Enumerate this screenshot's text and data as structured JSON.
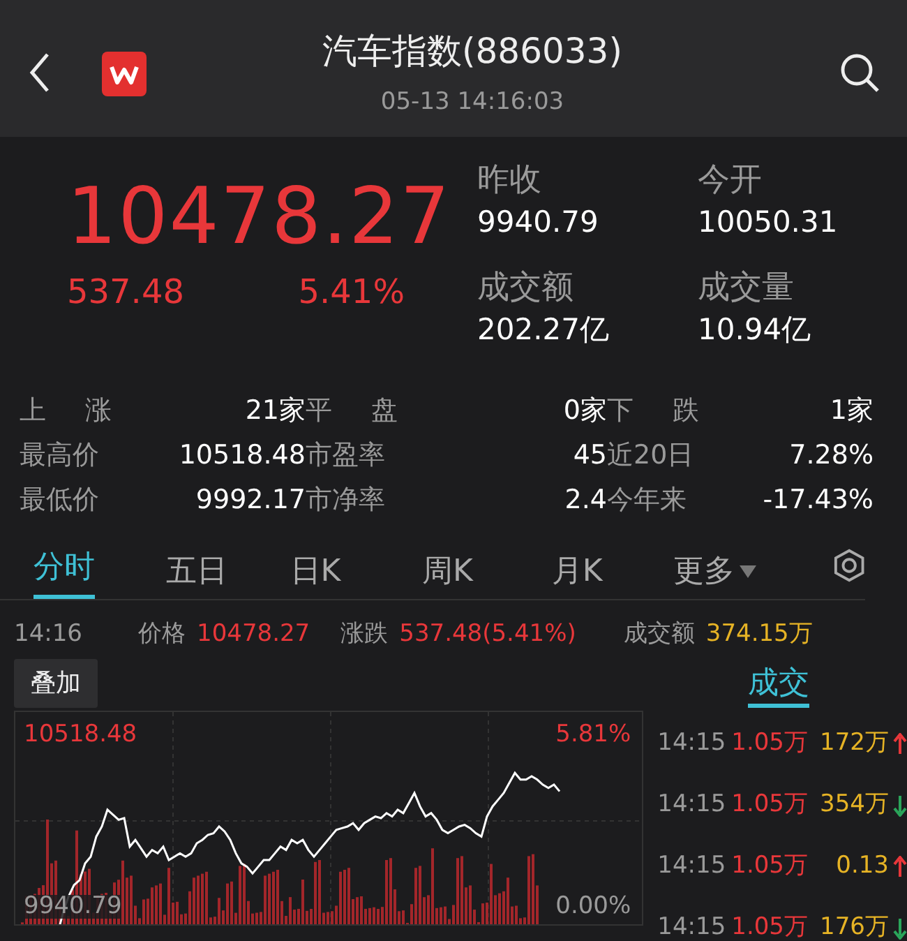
{
  "header": {
    "title": "汽车指数(886033)",
    "datetime": "05-13 14:16:03"
  },
  "quote": {
    "price": "10478.27",
    "change": "537.48",
    "change_pct": "5.41%"
  },
  "summary": [
    {
      "label": "昨收",
      "value": "9940.79"
    },
    {
      "label": "今开",
      "value": "10050.31"
    },
    {
      "label": "成交额",
      "value": "202.27亿"
    },
    {
      "label": "成交量",
      "value": "10.94亿"
    }
  ],
  "stats": [
    [
      {
        "label": "上 涨",
        "value": "21家"
      },
      {
        "label": "平 盘",
        "value": "0家"
      },
      {
        "label": "下 跌",
        "value": "1家"
      }
    ],
    [
      {
        "label": "最高价",
        "value": "10518.48"
      },
      {
        "label": "市盈率",
        "value": "45"
      },
      {
        "label": "近20日",
        "value": "7.28%"
      }
    ],
    [
      {
        "label": "最低价",
        "value": "9992.17"
      },
      {
        "label": "市净率",
        "value": "2.4"
      },
      {
        "label": "今年来",
        "value": "-17.43%"
      }
    ]
  ],
  "tabs": [
    {
      "label": "分时",
      "selected": true,
      "kind": "plain"
    },
    {
      "label": "五日",
      "selected": false,
      "kind": "plain"
    },
    {
      "label": "日K",
      "selected": false,
      "kind": "plain"
    },
    {
      "label": "周K",
      "selected": false,
      "kind": "plain"
    },
    {
      "label": "月K",
      "selected": false,
      "kind": "plain"
    },
    {
      "label": "更多",
      "selected": false,
      "kind": "dropdown"
    }
  ],
  "info": {
    "time": "14:16",
    "price_label": "价格",
    "price": "10478.27",
    "change_label": "涨跌",
    "change": "537.48(5.41%)",
    "amount_label": "成交额",
    "amount": "374.15万"
  },
  "overlay_button": "叠加",
  "chart": {
    "high_label": "10518.48",
    "high_pct": "5.81%",
    "low_label": "9940.79",
    "low_pct": "0.00%"
  },
  "trades_tab": {
    "label": "成交",
    "selected": true
  },
  "trades": [
    {
      "time": "14:15",
      "price": "1.05万",
      "volume": "172万",
      "kind": "up"
    },
    {
      "time": "14:15",
      "price": "1.05万",
      "volume": "354万",
      "kind": "down"
    },
    {
      "time": "14:15",
      "price": "1.05万",
      "volume": "0.13",
      "kind": "up"
    },
    {
      "time": "14:15",
      "price": "1.05万",
      "volume": "176万",
      "kind": "down"
    }
  ]
}
